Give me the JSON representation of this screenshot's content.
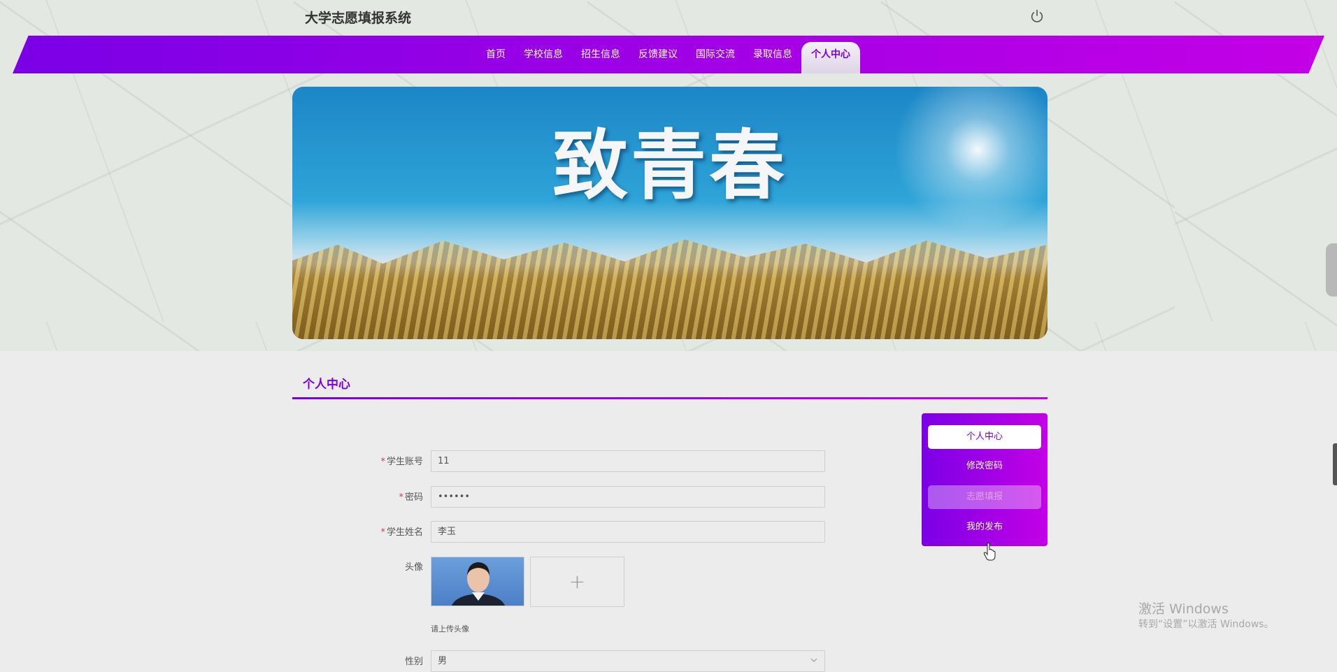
{
  "header": {
    "title": "大学志愿填报系统",
    "power_icon": "power-icon"
  },
  "nav": {
    "items": [
      "首页",
      "学校信息",
      "招生信息",
      "反馈建议",
      "国际交流",
      "录取信息",
      "个人中心"
    ],
    "active_index": 6
  },
  "banner": {
    "slogan": "致青春"
  },
  "section": {
    "title": "个人中心"
  },
  "form": {
    "student_account": {
      "label": "学生账号",
      "value": "11"
    },
    "password": {
      "label": "密码",
      "value": "••••••"
    },
    "student_name": {
      "label": "学生姓名",
      "value": "李玉"
    },
    "avatar": {
      "label": "头像",
      "upload_hint": "请上传头像"
    },
    "gender": {
      "label": "性别",
      "value": "男"
    }
  },
  "side_menu": {
    "items": [
      "个人中心",
      "修改密码",
      "志愿填报",
      "我的发布"
    ],
    "active_index": 0,
    "hover_index": 2
  },
  "watermark": {
    "title": "激活 Windows",
    "subtitle": "转到“设置”以激活 Windows。"
  },
  "colors": {
    "accent_start": "#7b00e6",
    "accent_end": "#c400e6",
    "required": "#e53935"
  }
}
